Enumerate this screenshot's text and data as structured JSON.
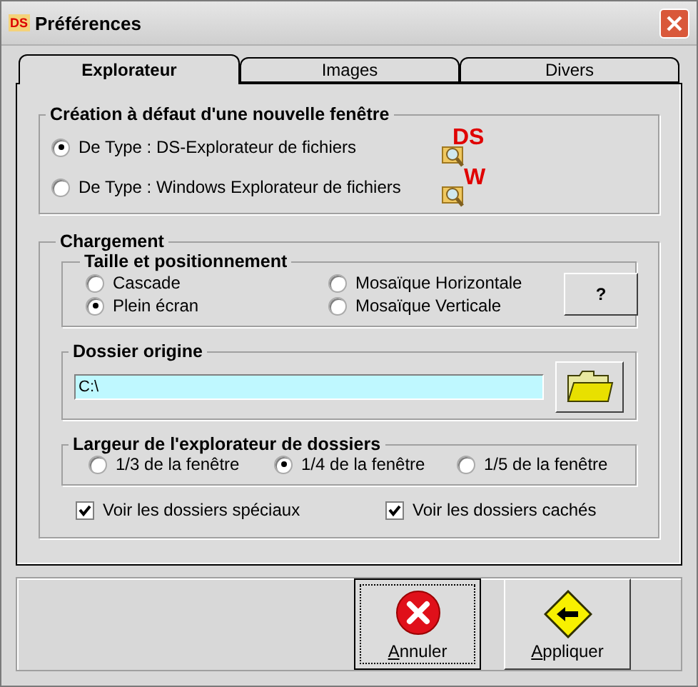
{
  "window": {
    "title": "Préférences",
    "icon_text": "DS"
  },
  "tabs": [
    {
      "label": "Explorateur",
      "selected": true
    },
    {
      "label": "Images",
      "selected": false
    },
    {
      "label": "Divers",
      "selected": false
    }
  ],
  "default_window": {
    "legend": "Création à défaut d'une nouvelle fenêtre",
    "options": [
      {
        "label": "De Type : DS-Explorateur de fichiers",
        "selected": true,
        "icon_text": "DS"
      },
      {
        "label": "De Type : Windows Explorateur de fichiers",
        "selected": false,
        "icon_text": "W"
      }
    ]
  },
  "loading": {
    "legend": "Chargement",
    "size_position": {
      "legend": "Taille et positionnement",
      "help_button": "?",
      "options": [
        {
          "label": "Cascade",
          "selected": false
        },
        {
          "label": "Plein écran",
          "selected": true
        },
        {
          "label": "Mosaïque Horizontale",
          "selected": false
        },
        {
          "label": "Mosaïque Verticale",
          "selected": false
        }
      ]
    },
    "root_folder": {
      "legend": "Dossier origine",
      "value": "C:\\"
    },
    "explorer_width": {
      "legend": "Largeur de l'explorateur de dossiers",
      "options": [
        {
          "label": "1/3 de la fenêtre",
          "selected": false
        },
        {
          "label": "1/4 de la fenêtre",
          "selected": true
        },
        {
          "label": "1/5 de la fenêtre",
          "selected": false
        }
      ]
    },
    "checkboxes": [
      {
        "label": "Voir les dossiers spéciaux",
        "checked": true
      },
      {
        "label": "Voir les dossiers cachés",
        "checked": true
      }
    ]
  },
  "buttons": [
    {
      "label": "Annuler",
      "kind": "cancel",
      "focused": true
    },
    {
      "label": "Appliquer",
      "kind": "apply",
      "focused": false
    }
  ]
}
